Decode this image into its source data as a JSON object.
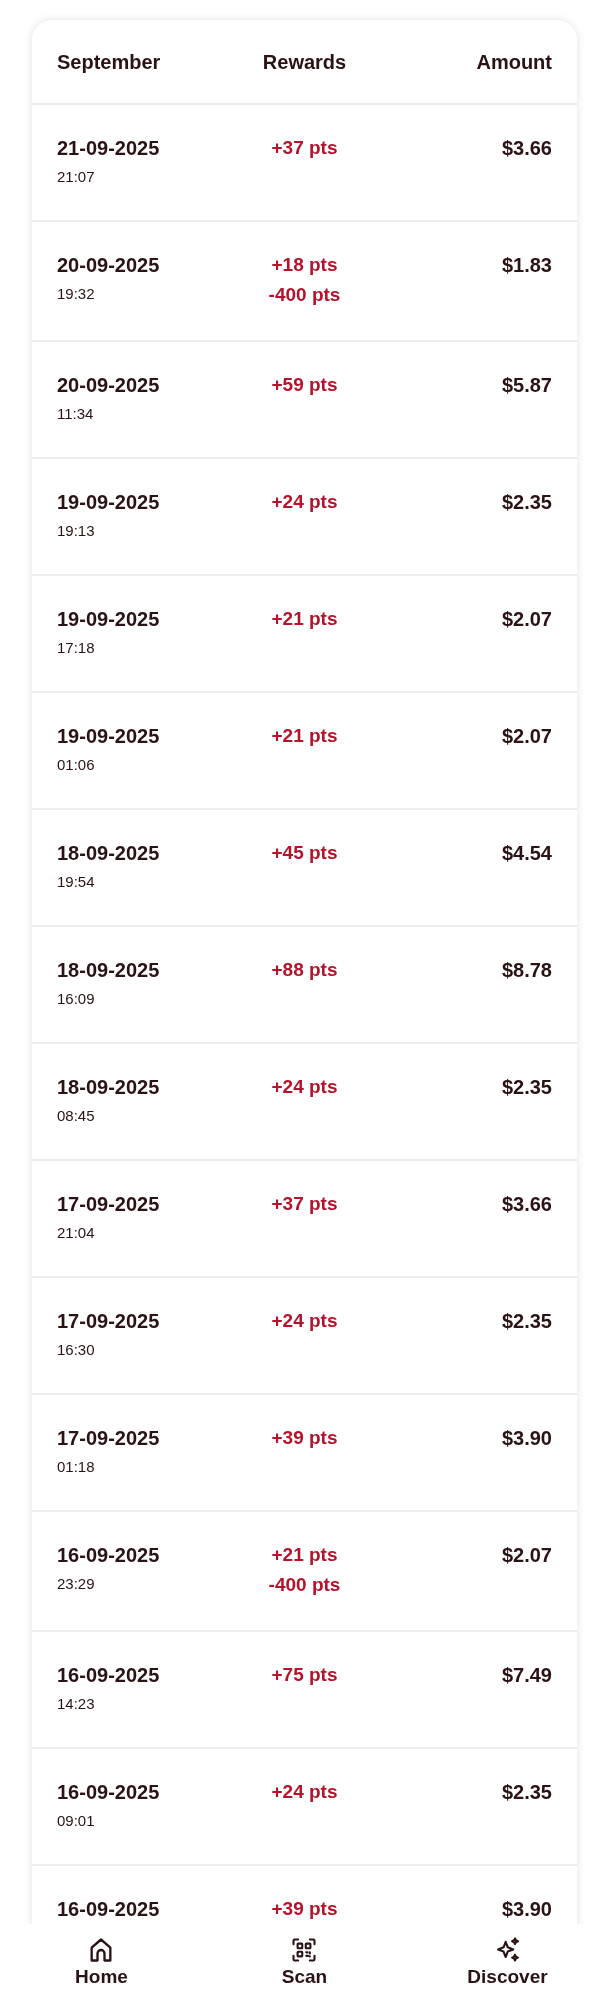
{
  "table": {
    "columns": [
      "September",
      "Rewards",
      "Amount"
    ],
    "rows": [
      {
        "date": "21-09-2025",
        "time": "21:07",
        "rewards": [
          "+37 pts"
        ],
        "amount": "$3.66"
      },
      {
        "date": "20-09-2025",
        "time": "19:32",
        "rewards": [
          "+18 pts",
          "-400 pts"
        ],
        "amount": "$1.83"
      },
      {
        "date": "20-09-2025",
        "time": "11:34",
        "rewards": [
          "+59 pts"
        ],
        "amount": "$5.87"
      },
      {
        "date": "19-09-2025",
        "time": "19:13",
        "rewards": [
          "+24 pts"
        ],
        "amount": "$2.35"
      },
      {
        "date": "19-09-2025",
        "time": "17:18",
        "rewards": [
          "+21 pts"
        ],
        "amount": "$2.07"
      },
      {
        "date": "19-09-2025",
        "time": "01:06",
        "rewards": [
          "+21 pts"
        ],
        "amount": "$2.07"
      },
      {
        "date": "18-09-2025",
        "time": "19:54",
        "rewards": [
          "+45 pts"
        ],
        "amount": "$4.54"
      },
      {
        "date": "18-09-2025",
        "time": "16:09",
        "rewards": [
          "+88 pts"
        ],
        "amount": "$8.78"
      },
      {
        "date": "18-09-2025",
        "time": "08:45",
        "rewards": [
          "+24 pts"
        ],
        "amount": "$2.35"
      },
      {
        "date": "17-09-2025",
        "time": "21:04",
        "rewards": [
          "+37 pts"
        ],
        "amount": "$3.66"
      },
      {
        "date": "17-09-2025",
        "time": "16:30",
        "rewards": [
          "+24 pts"
        ],
        "amount": "$2.35"
      },
      {
        "date": "17-09-2025",
        "time": "01:18",
        "rewards": [
          "+39 pts"
        ],
        "amount": "$3.90"
      },
      {
        "date": "16-09-2025",
        "time": "23:29",
        "rewards": [
          "+21 pts",
          "-400 pts"
        ],
        "amount": "$2.07"
      },
      {
        "date": "16-09-2025",
        "time": "14:23",
        "rewards": [
          "+75 pts"
        ],
        "amount": "$7.49"
      },
      {
        "date": "16-09-2025",
        "time": "09:01",
        "rewards": [
          "+24 pts"
        ],
        "amount": "$2.35"
      },
      {
        "date": "16-09-2025",
        "rewards": [
          "+39 pts"
        ],
        "amount": "$3.90"
      }
    ]
  },
  "bottom_nav": [
    {
      "kind": "home",
      "label": "Home"
    },
    {
      "kind": "scan",
      "label": "Scan"
    },
    {
      "kind": "discover",
      "label": "Discover"
    }
  ]
}
